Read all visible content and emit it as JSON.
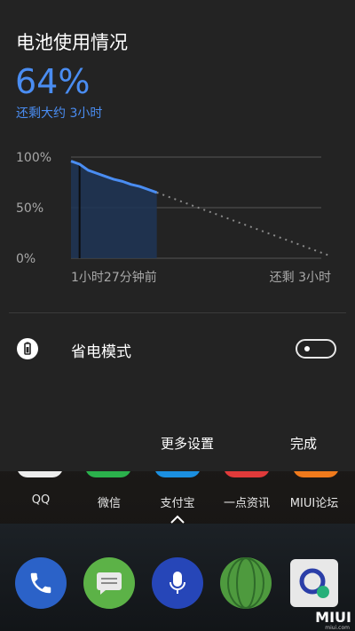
{
  "battery_panel": {
    "title": "电池使用情况",
    "percent": "64%",
    "remaining": "还剩大约 3小时",
    "chart": {
      "y_ticks": [
        "100%",
        "50%",
        "0%"
      ],
      "x_start_label": "1小时27分钟前",
      "x_end_label": "还剩 3小时"
    },
    "power_saver": {
      "label": "省电模式",
      "enabled": false
    },
    "more_settings_label": "更多设置",
    "done_label": "完成"
  },
  "chart_data": {
    "type": "line",
    "title": "",
    "xlabel": "",
    "ylabel": "",
    "ylim": [
      0,
      100
    ],
    "x_labels": [
      "1小时27分钟前",
      "还剩 3小时"
    ],
    "series": [
      {
        "style": "solid",
        "x": [
          0,
          0.1,
          0.2,
          0.3,
          0.4,
          0.5,
          0.6,
          0.7,
          0.8,
          0.9,
          1.0
        ],
        "values": [
          96,
          93,
          87,
          84,
          81,
          78,
          76,
          73,
          71,
          68,
          65
        ]
      },
      {
        "style": "dotted",
        "x": [
          1.0,
          3.0
        ],
        "values": [
          65,
          3
        ]
      }
    ],
    "colors": {
      "line": "#4a8df2",
      "projection": "#8a8a8a",
      "fill": "#1f3556"
    }
  },
  "home_screen": {
    "apps": [
      {
        "label": "QQ",
        "color": "#ededed"
      },
      {
        "label": "微信",
        "color": "#2bb14c"
      },
      {
        "label": "支付宝",
        "color": "#1b8fe0"
      },
      {
        "label": "一点资讯",
        "color": "#e03a3a"
      },
      {
        "label": "MIUI论坛",
        "color": "#f07a1c"
      }
    ],
    "dock": [
      {
        "name": "phone-icon",
        "color": "#2b62c8"
      },
      {
        "name": "messages-icon",
        "color": "#5cb247"
      },
      {
        "name": "microphone-icon",
        "color": "#2646b8"
      },
      {
        "name": "browser-icon",
        "color": "#4e9a3e"
      },
      {
        "name": "app-icon",
        "color": "#e8e8e8"
      }
    ],
    "brand": "MIUI",
    "brand_sub": "miui.com"
  }
}
